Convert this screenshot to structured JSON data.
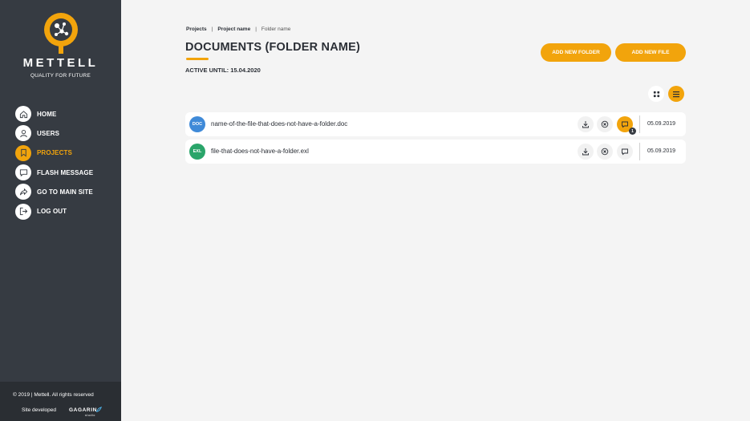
{
  "brand": {
    "name": "METTELL",
    "tagline": "QUALITY FOR FUTURE"
  },
  "colors": {
    "accent": "#f2a40c",
    "sidebar": "#363b42",
    "doc_badge": "#3f8ad8",
    "exl_badge": "#2aa56a"
  },
  "nav": {
    "items": [
      {
        "label": "HOME",
        "icon": "home-icon"
      },
      {
        "label": "USERS",
        "icon": "user-icon"
      },
      {
        "label": "PROJECTS",
        "icon": "bookmark-icon",
        "active": true
      },
      {
        "label": "FLASH MESSAGE",
        "icon": "message-icon"
      },
      {
        "label": "GO TO MAIN SITE",
        "icon": "share-arrow-icon"
      },
      {
        "label": "LOG OUT",
        "icon": "logout-icon"
      }
    ]
  },
  "footer": {
    "copyright": "© 2019   |   Mettell. All rights reserved",
    "developed": "Site developed",
    "developer": "GAGARIN",
    "developer_sub": "studio"
  },
  "breadcrumb": {
    "items": [
      "Projects",
      "Project name",
      "Folder name"
    ],
    "separator": "|"
  },
  "page": {
    "title": "DOCUMENTS (FOLDER NAME)",
    "active_until": "ACTIVE UNTIL: 15.04.2020"
  },
  "actions": {
    "add_folder": "ADD NEW FOLDER",
    "add_file": "ADD NEW FILE"
  },
  "view": {
    "grid_icon": "grid-icon",
    "list_icon": "list-icon",
    "selected": "list"
  },
  "files": [
    {
      "badge": "DOC",
      "name": "name-of-the-file-that-does-not-have-a-folder.doc",
      "date": "05.09.2019",
      "comments": "1"
    },
    {
      "badge": "EXL",
      "name": "file-that-does-not-have-a-folder.exl",
      "date": "05.09.2019"
    }
  ]
}
